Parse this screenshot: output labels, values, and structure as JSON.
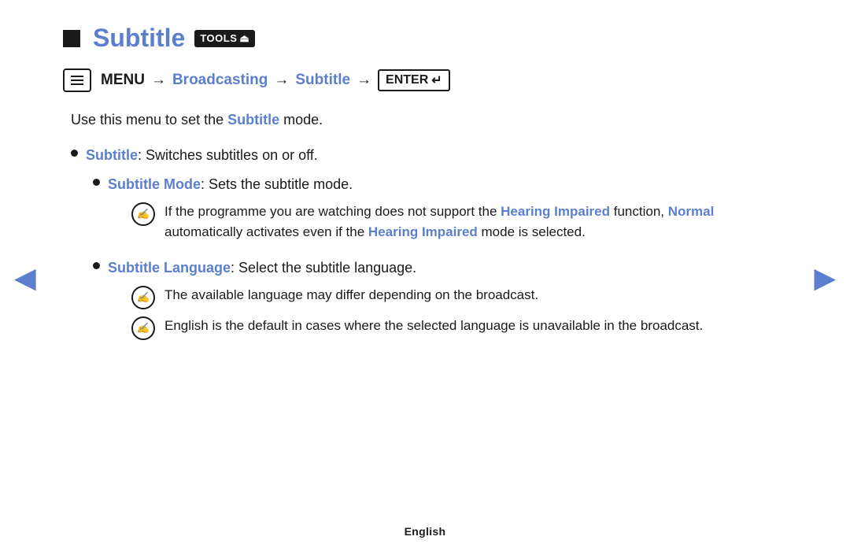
{
  "page": {
    "title": "Subtitle",
    "tools_label": "TOOLS",
    "breadcrumb": {
      "menu_label": "MENU",
      "broadcasting": "Broadcasting",
      "subtitle": "Subtitle",
      "enter_label": "ENTER"
    },
    "intro": {
      "text_before": "Use this menu to set the ",
      "link": "Subtitle",
      "text_after": " mode."
    },
    "bullet1": {
      "link": "Subtitle",
      "text": ": Switches subtitles on or off."
    },
    "sub_bullet1": {
      "link": "Subtitle Mode",
      "text": ": Sets the subtitle mode."
    },
    "note1": {
      "text_before": "If the programme you are watching does not support the ",
      "link1": "Hearing Impaired",
      "text_middle1": " function, ",
      "link2": "Normal",
      "text_middle2": " automatically activates even if the ",
      "link3": "Hearing Impaired",
      "text_after": " mode is selected."
    },
    "sub_bullet2": {
      "link": "Subtitle Language",
      "text": ": Select the subtitle language."
    },
    "note2": {
      "text": "The available language may differ depending on the broadcast."
    },
    "note3": {
      "text_before": "English is the default in cases where the selected language is unavailable in the broadcast."
    },
    "footer": "English",
    "nav": {
      "left_label": "previous",
      "right_label": "next"
    }
  }
}
